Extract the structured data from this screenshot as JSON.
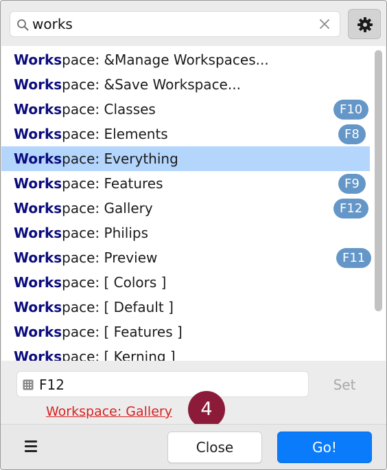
{
  "search": {
    "value": "works",
    "icon": "search-icon",
    "clear_icon": "close-icon",
    "settings_icon": "gear-icon"
  },
  "results": [
    {
      "match": "Works",
      "rest": "pace: &Manage Workspaces...",
      "shortcut": ""
    },
    {
      "match": "Works",
      "rest": "pace: &Save Workspace...",
      "shortcut": ""
    },
    {
      "match": "Works",
      "rest": "pace: Classes",
      "shortcut": "F10"
    },
    {
      "match": "Works",
      "rest": "pace: Elements",
      "shortcut": "F8"
    },
    {
      "match": "Works",
      "rest": "pace: Everything",
      "shortcut": "",
      "selected": true
    },
    {
      "match": "Works",
      "rest": "pace: Features",
      "shortcut": "F9"
    },
    {
      "match": "Works",
      "rest": "pace: Gallery",
      "shortcut": "F12"
    },
    {
      "match": "Works",
      "rest": "pace: Philips",
      "shortcut": ""
    },
    {
      "match": "Works",
      "rest": "pace: Preview",
      "shortcut": "F11"
    },
    {
      "match": "Works",
      "rest": "pace: [ Colors ]",
      "shortcut": ""
    },
    {
      "match": "Works",
      "rest": "pace: [ Default ]",
      "shortcut": ""
    },
    {
      "match": "Works",
      "rest": "pace: [ Features ]",
      "shortcut": ""
    },
    {
      "match": "Works",
      "rest": "pace: [ Kerning ]",
      "shortcut": ""
    }
  ],
  "shortcut_editor": {
    "value": "F12",
    "icon": "keyboard-icon",
    "set_label": "Set",
    "conflict_label": "Workspace: Gallery"
  },
  "step_badge": "4",
  "footer": {
    "menu_icon": "hamburger-menu-icon",
    "close_label": "Close",
    "go_label": "Go!"
  },
  "colors": {
    "match_text": "#0b0c7c",
    "selected_row": "#b4d5fc",
    "shortcut_badge": "#6496c8",
    "conflict_link": "#d92121",
    "step_badge": "#8c1b3a",
    "go_button": "#0a7bfa"
  }
}
